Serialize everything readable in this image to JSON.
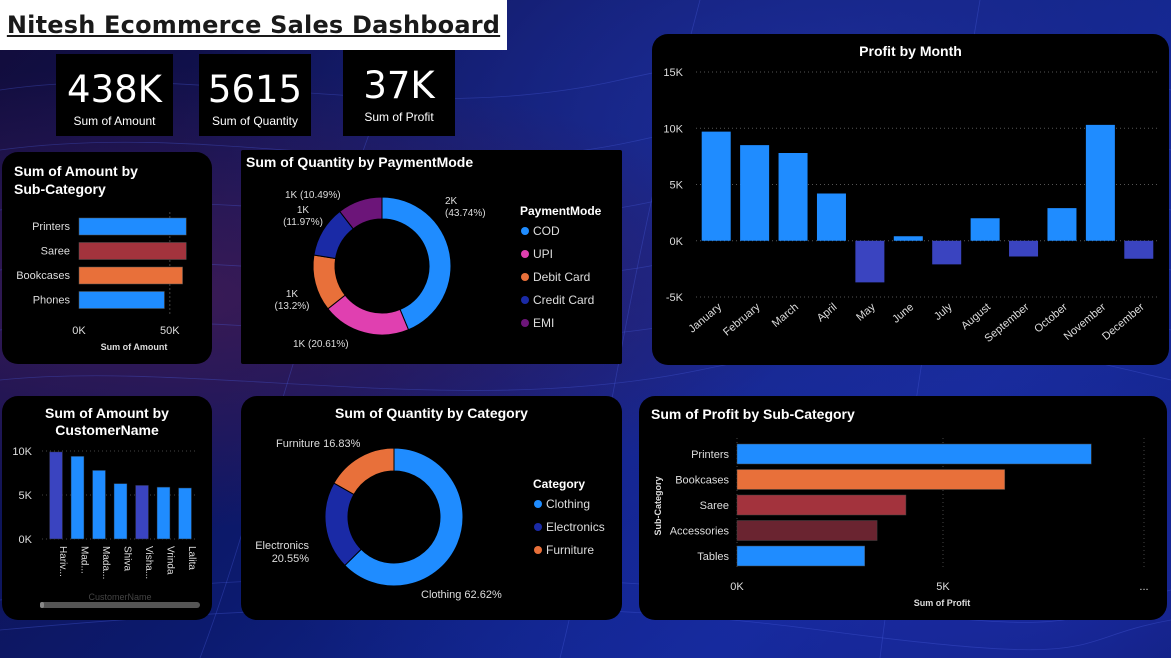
{
  "header": {
    "title": "Nitesh Ecommerce Sales Dashboard"
  },
  "kpis": [
    {
      "value": "438K",
      "label": "Sum of Amount"
    },
    {
      "value": "5615",
      "label": "Sum of Quantity"
    },
    {
      "value": "37K",
      "label": "Sum of Profit"
    }
  ],
  "colors": {
    "blue": "#1f8cff",
    "maroon": "#a3333d",
    "orange": "#e8703a",
    "navy": "#1a2aa6",
    "purple": "#6c1579",
    "pink": "#e040b0",
    "indigo": "#3a44c0",
    "darkred": "#6a2430"
  },
  "chart_data": [
    {
      "id": "amount_by_subcategory",
      "type": "bar",
      "title": "Sum of Amount by Sub-Category",
      "xlabel": "Sum of Amount",
      "ylabel": "",
      "categories": [
        "Printers",
        "Saree",
        "Bookcases",
        "Phones"
      ],
      "values": [
        59000,
        59000,
        57000,
        47000
      ],
      "colors": [
        "#1f8cff",
        "#a3333d",
        "#e8703a",
        "#1f8cff"
      ],
      "xlim": [
        0,
        60000
      ],
      "ticks": [
        "0K",
        "50K"
      ]
    },
    {
      "id": "quantity_by_paymentmode",
      "type": "pie",
      "title": "Sum of Quantity by PaymentMode",
      "legend_title": "PaymentMode",
      "legend_placement": "right",
      "categories": [
        "COD",
        "UPI",
        "Debit Card",
        "Credit Card",
        "EMI"
      ],
      "values": [
        43.74,
        20.61,
        13.2,
        11.97,
        10.49
      ],
      "labels": [
        "2K (43.74%)",
        "1K (20.61%)",
        "1K (13.2%)",
        "1K (11.97%)",
        "1K (10.49%)"
      ],
      "colors": [
        "#1f8cff",
        "#e040b0",
        "#e8703a",
        "#1a2aa6",
        "#6c1579"
      ]
    },
    {
      "id": "profit_by_month",
      "type": "bar",
      "title": "Profit by Month",
      "categories": [
        "January",
        "February",
        "March",
        "April",
        "May",
        "June",
        "July",
        "August",
        "September",
        "October",
        "November",
        "December"
      ],
      "values": [
        9700,
        8500,
        7800,
        4200,
        -3700,
        400,
        -2100,
        2000,
        -1400,
        2900,
        10300,
        -1600
      ],
      "ylim": [
        -5000,
        15000
      ],
      "ticks": [
        "-5K",
        "0K",
        "5K",
        "10K",
        "15K"
      ],
      "pos_color": "#1f8cff",
      "neg_color": "#3a44c0"
    },
    {
      "id": "amount_by_customer",
      "type": "bar",
      "title": "Sum of Amount by CustomerName",
      "xlabel": "CustomerName",
      "categories": [
        "Hariv...",
        "Mad...",
        "Mada...",
        "Shiva",
        "Visha...",
        "Vrinda",
        "Lalita"
      ],
      "values": [
        9900,
        9400,
        7800,
        6300,
        6100,
        5900,
        5800
      ],
      "colors": [
        "#3a44c0",
        "#1f8cff",
        "#1f8cff",
        "#1f8cff",
        "#3a44c0",
        "#1f8cff",
        "#1f8cff"
      ],
      "ylim": [
        0,
        10000
      ],
      "ticks": [
        "0K",
        "5K",
        "10K"
      ]
    },
    {
      "id": "quantity_by_category",
      "type": "pie",
      "title": "Sum of Quantity by Category",
      "legend_title": "Category",
      "legend_placement": "right",
      "categories": [
        "Clothing",
        "Electronics",
        "Furniture"
      ],
      "values": [
        62.62,
        20.55,
        16.83
      ],
      "labels": [
        "Clothing 62.62%",
        "Electronics 20.55%",
        "Furniture 16.83%"
      ],
      "colors": [
        "#1f8cff",
        "#1a2aa6",
        "#e8703a"
      ]
    },
    {
      "id": "profit_by_subcategory",
      "type": "bar",
      "title": "Sum of Profit by Sub-Category",
      "xlabel": "Sum of Profit",
      "ylabel": "Sub-Category",
      "categories": [
        "Printers",
        "Bookcases",
        "Saree",
        "Accessories",
        "Tables"
      ],
      "values": [
        8600,
        6500,
        4100,
        3400,
        3100
      ],
      "colors": [
        "#1f8cff",
        "#e8703a",
        "#a3333d",
        "#6a2430",
        "#1f8cff"
      ],
      "xlim": [
        0,
        10000
      ],
      "ticks": [
        "0K",
        "5K",
        "..."
      ]
    }
  ]
}
